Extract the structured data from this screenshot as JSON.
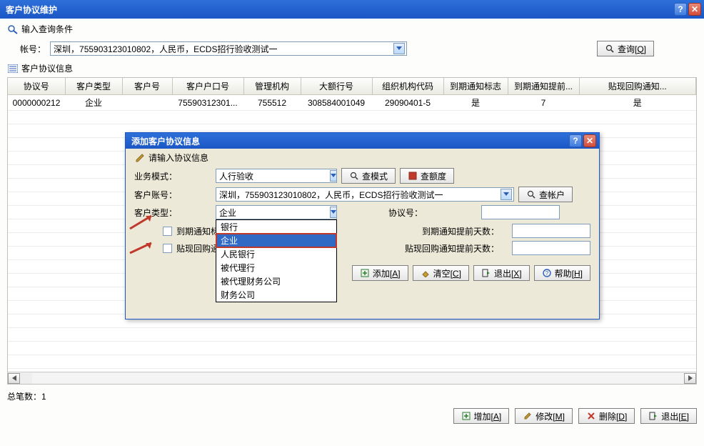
{
  "window": {
    "title": "客户协议维护",
    "help_btn": "?",
    "close_btn": "✕"
  },
  "section1": {
    "icon_hint": "magnifier-icon",
    "label": "输入查询条件"
  },
  "account": {
    "label": "帐号：",
    "value": "深圳，755903123010802，人民币，ECDS招行验收测试一"
  },
  "query_btn": {
    "icon": "magnifier",
    "label": "查询[",
    "hotkey": "Q",
    "suffix": "]"
  },
  "section2": {
    "icon_hint": "list-icon",
    "label": "客户协议信息"
  },
  "table": {
    "headers": [
      "协议号",
      "客户类型",
      "客户号",
      "客户户口号",
      "管理机构",
      "大额行号",
      "组织机构代码",
      "到期通知标志",
      "到期通知提前...",
      "贴现回购通知..."
    ],
    "row": {
      "agreement_no": "0000000212",
      "cust_type": "企业",
      "cust_no": "",
      "cust_acct": "75590312301...",
      "mgmt_org": "755512",
      "large_bank": "308584001049",
      "org_code": "29090401-5",
      "due_flag": "是",
      "due_advance": "7",
      "disc_flag": "是"
    }
  },
  "footer": {
    "total_label": "总笔数：",
    "total_value": "1"
  },
  "bottom_btns": {
    "add": {
      "label": "增加[",
      "hotkey": "A",
      "suffix": "]"
    },
    "edit": {
      "label": "修改[",
      "hotkey": "M",
      "suffix": "]"
    },
    "delete": {
      "label": "删除[",
      "hotkey": "D",
      "suffix": "]"
    },
    "exit": {
      "label": "退出[",
      "hotkey": "E",
      "suffix": "]"
    }
  },
  "dialog": {
    "title": "添加客户协议信息",
    "section_label": "请输入协议信息",
    "biz_mode_label": "业务模式：",
    "biz_mode_value": "人行验收",
    "check_mode_btn": "查模式",
    "check_quota_btn": "查额度",
    "cust_acct_label": "客户账号：",
    "cust_acct_value": "深圳，755903123010802，人民币，ECDS招行验收测试一",
    "check_acct_btn": "查帐户",
    "cust_type_label": "客户类型：",
    "cust_type_value": "企业",
    "agreement_label": "协议号：",
    "agreement_value": "",
    "due_flag_label": "到期通知标志",
    "due_days_label": "到期通知提前天数：",
    "due_days_value": "",
    "disc_flag_label": "贴现回购通知标",
    "disc_days_label": "贴现回购通知提前天数：",
    "disc_days_value": "",
    "dropdown_options": [
      "银行",
      "企业",
      "人民银行",
      "被代理行",
      "被代理财务公司",
      "财务公司"
    ],
    "dropdown_selected": "企业",
    "btns": {
      "add": {
        "label": "添加[",
        "hotkey": "A",
        "suffix": "]"
      },
      "clear": {
        "label": "清空[",
        "hotkey": "C",
        "suffix": "]"
      },
      "exit": {
        "label": "退出[",
        "hotkey": "X",
        "suffix": "]"
      },
      "help": {
        "label": "帮助[",
        "hotkey": "H",
        "suffix": "]"
      }
    }
  }
}
